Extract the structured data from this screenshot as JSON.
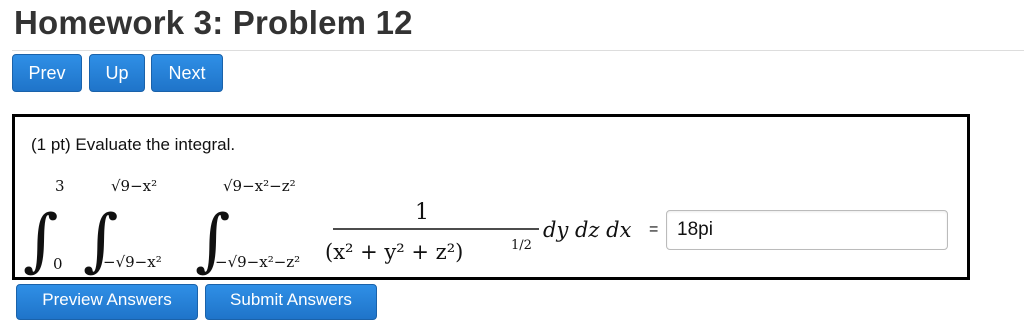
{
  "header": {
    "title": "Homework 3: Problem 12"
  },
  "nav": {
    "prev_label": "Prev",
    "up_label": "Up",
    "next_label": "Next"
  },
  "problem": {
    "prompt": "(1 pt) Evaluate the integral.",
    "math": {
      "outer_upper": "3",
      "outer_lower": "0",
      "middle_upper": "√9−x²",
      "middle_lower": "−√9−x²",
      "inner_upper": "√9−x²−z²",
      "inner_lower": "−√9−x²−z²",
      "numerator": "1",
      "denominator": "(x² + y² + z²)",
      "denominator_exponent": "1/2",
      "differentials": "dy dz dx"
    },
    "equals": "=",
    "answer_value": "18pi"
  },
  "actions": {
    "preview_label": "Preview Answers",
    "submit_label": "Submit Answers"
  },
  "colors": {
    "button_blue": "#2a85dc",
    "box_border": "#000000",
    "title_text": "#333333"
  }
}
